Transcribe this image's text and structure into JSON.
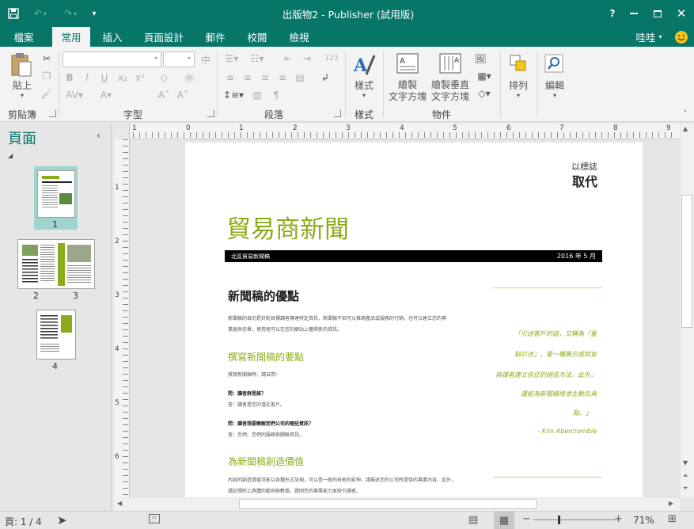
{
  "titlebar": {
    "title": "出版物2 - Publisher (試用版)",
    "help": "?"
  },
  "tabs": [
    {
      "label": "檔案"
    },
    {
      "label": "常用"
    },
    {
      "label": "插入"
    },
    {
      "label": "頁面設計"
    },
    {
      "label": "郵件"
    },
    {
      "label": "校閱"
    },
    {
      "label": "檢視"
    }
  ],
  "user": {
    "name": "哇哇"
  },
  "ribbon": {
    "paste_label": "貼上",
    "group_clipboard": "剪貼簿",
    "group_font": "字型",
    "group_paragraph": "段落",
    "group_styles": "樣式",
    "group_objects": "物件",
    "styles_label": "樣式",
    "draw_textbox_label": [
      "繪製",
      "文字方塊"
    ],
    "draw_vertical_textbox_label": [
      "繪製垂直",
      "文字方塊"
    ],
    "arrange_label": "排列",
    "edit_label": "編輯"
  },
  "pages_pane": {
    "title": "頁面",
    "pages": [
      {
        "label": "1"
      },
      {
        "label": "2"
      },
      {
        "label": "3"
      },
      {
        "label": "4"
      }
    ]
  },
  "ruler": {
    "h_labels": [
      "1",
      "0",
      "1",
      "2",
      "3",
      "4",
      "5",
      "6",
      "7",
      "8",
      "9"
    ],
    "v_labels": [
      "1",
      "2",
      "3",
      "4",
      "5",
      "6"
    ]
  },
  "doc": {
    "logo_small": "以標誌",
    "logo_big": "取代",
    "title": "貿易商新聞",
    "bar_left": "北區貿易新聞稿",
    "bar_right": "2016 年 5 月",
    "h1": "新聞稿的優點",
    "p1a": "新聞稿的目的是針對目標讀者傳達特定資訊，新聞稿不但可以推銷產品或服務的行銷，也可以建立您的專",
    "p1b": "業度與信譽，使用者可以在您的網站上獲得新的資訊。",
    "h2": "撰寫新聞稿的要點",
    "p2": "撰寫新聞稿時，請自問：",
    "q1": "問：讀者群是誰？",
    "a1": "答：讀者是您的潛在客戶。",
    "q2": "問：讀者想要瞭解您們公司的哪些資訊？",
    "a2": "答：您們、您們的服務與關聯資訊。",
    "h3": "為新聞稿創造價值",
    "p3a": "內容的創造價值可能以各種形式呈現，可以是一般的技術的延伸，請描述您的公司所提供的專業內容，此外，",
    "p3b": "請記得附上具體的範例與數據，證明您的專業能力並吸引讀者。",
    "quote": [
      "「引述客戶的話，又稱為『量",
      "點引述』，是一種展示成就並",
      "與讀者建立信任的絕佳方法，此外，",
      "還能為新聞稿增添生動且具",
      "點。」"
    ],
    "quote_author": "- Kim Abercrombie"
  },
  "status": {
    "page_info": "頁: 1 / 4",
    "zoom": "71%"
  },
  "colors": {
    "accent": "#077568",
    "doc_green": "#8aab1a"
  }
}
